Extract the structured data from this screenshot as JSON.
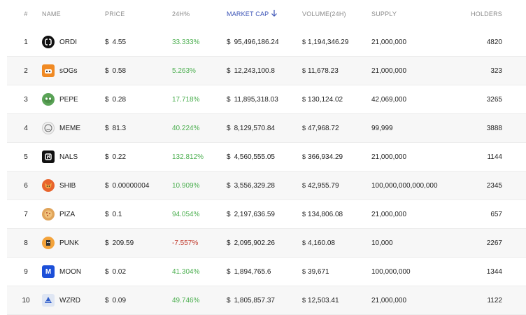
{
  "columns": {
    "rank": "#",
    "name": "NAME",
    "price": "PRICE",
    "change": "24H%",
    "market_cap": "MARKET CAP",
    "volume": "VOLUME(24H)",
    "supply": "SUPPLY",
    "holders": "HOLDERS"
  },
  "sort_icon": "arrow-down-icon",
  "currency": "$",
  "colors": {
    "positive": "#4caf50",
    "negative": "#c0392b",
    "sort_accent": "#3b53b6"
  },
  "rows": [
    {
      "rank": "1",
      "name": "ORDI",
      "icon": "ordi-icon",
      "price": "4.55",
      "change": "33.333%",
      "market_cap": "95,496,186.24",
      "volume": "1,194,346.29",
      "supply": "21,000,000",
      "holders": "4820"
    },
    {
      "rank": "2",
      "name": "sOGs",
      "icon": "sogs-icon",
      "price": "0.58",
      "change": "5.263%",
      "market_cap": "12,243,100.8",
      "volume": "11,678.23",
      "supply": "21,000,000",
      "holders": "323"
    },
    {
      "rank": "3",
      "name": "PEPE",
      "icon": "pepe-icon",
      "price": "0.28",
      "change": "17.718%",
      "market_cap": "11,895,318.03",
      "volume": "130,124.02",
      "supply": "42,069,000",
      "holders": "3265"
    },
    {
      "rank": "4",
      "name": "MEME",
      "icon": "meme-icon",
      "price": "81.3",
      "change": "40.224%",
      "market_cap": "8,129,570.84",
      "volume": "47,968.72",
      "supply": "99,999",
      "holders": "3888"
    },
    {
      "rank": "5",
      "name": "NALS",
      "icon": "nals-icon",
      "price": "0.22",
      "change": "132.812%",
      "market_cap": "4,560,555.05",
      "volume": "366,934.29",
      "supply": "21,000,000",
      "holders": "1144"
    },
    {
      "rank": "6",
      "name": "SHIB",
      "icon": "shib-icon",
      "price": "0.00000004",
      "change": "10.909%",
      "market_cap": "3,556,329.28",
      "volume": "42,955.79",
      "supply": "100,000,000,000,000",
      "holders": "2345"
    },
    {
      "rank": "7",
      "name": "PIZA",
      "icon": "piza-icon",
      "price": "0.1",
      "change": "94.054%",
      "market_cap": "2,197,636.59",
      "volume": "134,806.08",
      "supply": "21,000,000",
      "holders": "657"
    },
    {
      "rank": "8",
      "name": "PUNK",
      "icon": "punk-icon",
      "price": "209.59",
      "change": "-7.557%",
      "market_cap": "2,095,902.26",
      "volume": "4,160.08",
      "supply": "10,000",
      "holders": "2267"
    },
    {
      "rank": "9",
      "name": "MOON",
      "icon": "moon-icon",
      "price": "0.02",
      "change": "41.304%",
      "market_cap": "1,894,765.6",
      "volume": "39,671",
      "supply": "100,000,000",
      "holders": "1344"
    },
    {
      "rank": "10",
      "name": "WZRD",
      "icon": "wzrd-icon",
      "price": "0.09",
      "change": "49.746%",
      "market_cap": "1,805,857.37",
      "volume": "12,503.41",
      "supply": "21,000,000",
      "holders": "1122"
    }
  ]
}
